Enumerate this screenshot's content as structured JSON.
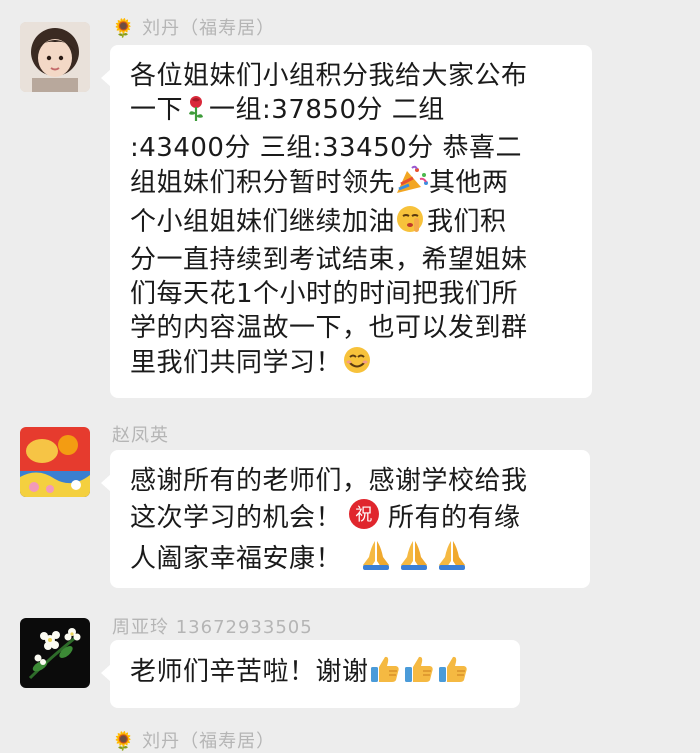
{
  "messages": [
    {
      "sender": "🌻 刘丹（福寿居）",
      "lines": [
        [
          "各位姐妹们小组积分我给大家公布"
        ],
        [
          "一下",
          "rose",
          "一组:37850分  二组"
        ],
        [
          ":43400分  三组:33450分  恭喜二"
        ],
        [
          "组姐妹们积分暂时领先",
          "party",
          "其他两"
        ],
        [
          "个小组姐妹们继续加油",
          "shush",
          "我们积"
        ],
        [
          "分一直持续到考试结束，希望姐妹"
        ],
        [
          "们每天花1个小时的时间把我们所"
        ],
        [
          "学的内容温故一下，也可以发到群"
        ],
        [
          "里我们共同学习！",
          "smile"
        ]
      ]
    },
    {
      "sender": "赵凤英",
      "lines": [
        [
          "感谢所有的老师们，感谢学校给我"
        ],
        [
          "这次学习的机会！",
          "zhu",
          "所有的有缘"
        ],
        [
          "人阖家幸福安康！",
          "pray",
          "pray",
          "pray"
        ]
      ]
    },
    {
      "sender": "周亚玲 13672933505",
      "lines": [
        [
          "老师们辛苦啦！谢谢",
          "thumb",
          "thumb",
          "thumb"
        ]
      ]
    },
    {
      "sender": "🌻 刘丹（福寿居）"
    }
  ],
  "zhu_char": "祝"
}
